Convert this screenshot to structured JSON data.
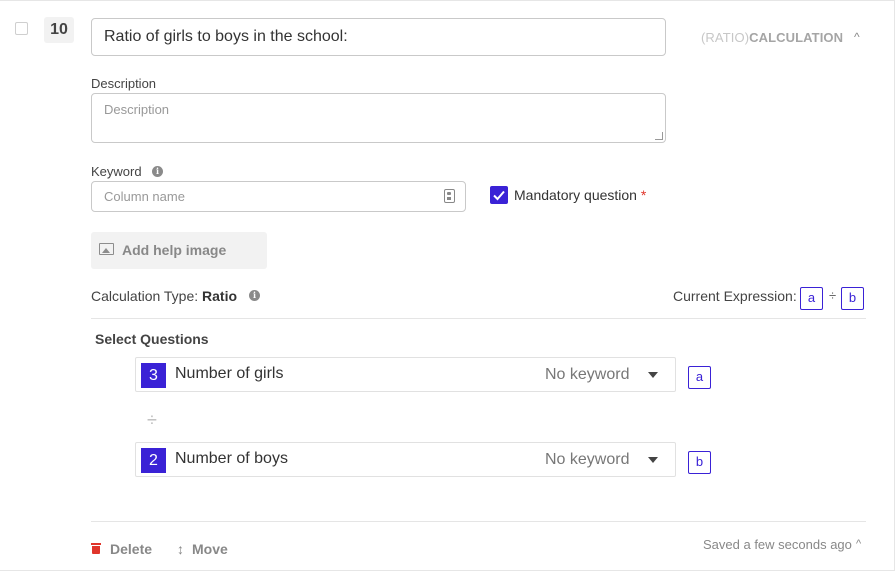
{
  "question": {
    "number": "10",
    "title_value": "Ratio of girls to boys in the school:",
    "type_prefix": "(RATIO)",
    "type_name": "CALCULATION",
    "collapse_glyph": "^"
  },
  "description": {
    "label": "Description",
    "placeholder": "Description"
  },
  "keyword": {
    "label": "Keyword",
    "placeholder": "Column name",
    "info_glyph": "i"
  },
  "mandatory": {
    "label": "Mandatory question",
    "required_marker": "*",
    "checked": true
  },
  "help_image": {
    "label": "Add help image"
  },
  "calculation": {
    "type_label": "Calculation Type:",
    "type_value": "Ratio",
    "info_glyph": "i",
    "expression_label": "Current Expression:",
    "expression_a": "a",
    "expression_op": "÷",
    "expression_b": "b"
  },
  "select_questions": {
    "label": "Select Questions",
    "divider_glyph": "÷",
    "rows": [
      {
        "number": "3",
        "text": "Number of girls",
        "keyword": "No keyword",
        "variable": "a"
      },
      {
        "number": "2",
        "text": "Number of boys",
        "keyword": "No keyword",
        "variable": "b"
      }
    ]
  },
  "footer": {
    "delete_label": "Delete",
    "move_label": "Move",
    "move_glyph": "↕",
    "saved_text": "Saved a few seconds ago",
    "saved_glyph": "^"
  },
  "colors": {
    "accent": "#3a22d6",
    "danger": "#e0352b"
  }
}
